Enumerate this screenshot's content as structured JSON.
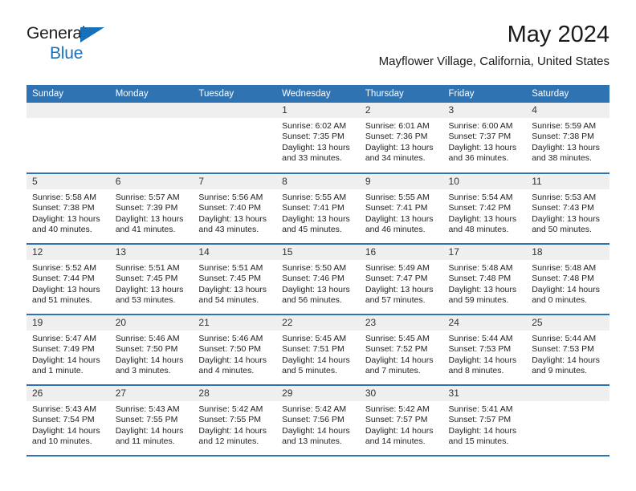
{
  "brand": {
    "name_part1": "General",
    "name_part2": "Blue",
    "triangle_color": "#1a70b8"
  },
  "header": {
    "title": "May 2024",
    "subtitle": "Mayflower Village, California, United States"
  },
  "colors": {
    "header_blue": "#2f73b3",
    "daynum_band": "#efefef",
    "cell_background": "#ffffff"
  },
  "calendar": {
    "weekday_headers": [
      "Sunday",
      "Monday",
      "Tuesday",
      "Wednesday",
      "Thursday",
      "Friday",
      "Saturday"
    ],
    "labels": {
      "sunrise": "Sunrise:",
      "sunset": "Sunset:",
      "daylight": "Daylight:"
    },
    "weeks": [
      [
        {
          "day": "",
          "empty": true,
          "sunrise": "",
          "sunset": "",
          "daylight_line1": "",
          "daylight_line2": ""
        },
        {
          "day": "",
          "empty": true,
          "sunrise": "",
          "sunset": "",
          "daylight_line1": "",
          "daylight_line2": ""
        },
        {
          "day": "",
          "empty": true,
          "sunrise": "",
          "sunset": "",
          "daylight_line1": "",
          "daylight_line2": ""
        },
        {
          "day": "1",
          "empty": false,
          "sunrise": "Sunrise: 6:02 AM",
          "sunset": "Sunset: 7:35 PM",
          "daylight_line1": "Daylight: 13 hours",
          "daylight_line2": "and 33 minutes."
        },
        {
          "day": "2",
          "empty": false,
          "sunrise": "Sunrise: 6:01 AM",
          "sunset": "Sunset: 7:36 PM",
          "daylight_line1": "Daylight: 13 hours",
          "daylight_line2": "and 34 minutes."
        },
        {
          "day": "3",
          "empty": false,
          "sunrise": "Sunrise: 6:00 AM",
          "sunset": "Sunset: 7:37 PM",
          "daylight_line1": "Daylight: 13 hours",
          "daylight_line2": "and 36 minutes."
        },
        {
          "day": "4",
          "empty": false,
          "sunrise": "Sunrise: 5:59 AM",
          "sunset": "Sunset: 7:38 PM",
          "daylight_line1": "Daylight: 13 hours",
          "daylight_line2": "and 38 minutes."
        }
      ],
      [
        {
          "day": "5",
          "empty": false,
          "sunrise": "Sunrise: 5:58 AM",
          "sunset": "Sunset: 7:38 PM",
          "daylight_line1": "Daylight: 13 hours",
          "daylight_line2": "and 40 minutes."
        },
        {
          "day": "6",
          "empty": false,
          "sunrise": "Sunrise: 5:57 AM",
          "sunset": "Sunset: 7:39 PM",
          "daylight_line1": "Daylight: 13 hours",
          "daylight_line2": "and 41 minutes."
        },
        {
          "day": "7",
          "empty": false,
          "sunrise": "Sunrise: 5:56 AM",
          "sunset": "Sunset: 7:40 PM",
          "daylight_line1": "Daylight: 13 hours",
          "daylight_line2": "and 43 minutes."
        },
        {
          "day": "8",
          "empty": false,
          "sunrise": "Sunrise: 5:55 AM",
          "sunset": "Sunset: 7:41 PM",
          "daylight_line1": "Daylight: 13 hours",
          "daylight_line2": "and 45 minutes."
        },
        {
          "day": "9",
          "empty": false,
          "sunrise": "Sunrise: 5:55 AM",
          "sunset": "Sunset: 7:41 PM",
          "daylight_line1": "Daylight: 13 hours",
          "daylight_line2": "and 46 minutes."
        },
        {
          "day": "10",
          "empty": false,
          "sunrise": "Sunrise: 5:54 AM",
          "sunset": "Sunset: 7:42 PM",
          "daylight_line1": "Daylight: 13 hours",
          "daylight_line2": "and 48 minutes."
        },
        {
          "day": "11",
          "empty": false,
          "sunrise": "Sunrise: 5:53 AM",
          "sunset": "Sunset: 7:43 PM",
          "daylight_line1": "Daylight: 13 hours",
          "daylight_line2": "and 50 minutes."
        }
      ],
      [
        {
          "day": "12",
          "empty": false,
          "sunrise": "Sunrise: 5:52 AM",
          "sunset": "Sunset: 7:44 PM",
          "daylight_line1": "Daylight: 13 hours",
          "daylight_line2": "and 51 minutes."
        },
        {
          "day": "13",
          "empty": false,
          "sunrise": "Sunrise: 5:51 AM",
          "sunset": "Sunset: 7:45 PM",
          "daylight_line1": "Daylight: 13 hours",
          "daylight_line2": "and 53 minutes."
        },
        {
          "day": "14",
          "empty": false,
          "sunrise": "Sunrise: 5:51 AM",
          "sunset": "Sunset: 7:45 PM",
          "daylight_line1": "Daylight: 13 hours",
          "daylight_line2": "and 54 minutes."
        },
        {
          "day": "15",
          "empty": false,
          "sunrise": "Sunrise: 5:50 AM",
          "sunset": "Sunset: 7:46 PM",
          "daylight_line1": "Daylight: 13 hours",
          "daylight_line2": "and 56 minutes."
        },
        {
          "day": "16",
          "empty": false,
          "sunrise": "Sunrise: 5:49 AM",
          "sunset": "Sunset: 7:47 PM",
          "daylight_line1": "Daylight: 13 hours",
          "daylight_line2": "and 57 minutes."
        },
        {
          "day": "17",
          "empty": false,
          "sunrise": "Sunrise: 5:48 AM",
          "sunset": "Sunset: 7:48 PM",
          "daylight_line1": "Daylight: 13 hours",
          "daylight_line2": "and 59 minutes."
        },
        {
          "day": "18",
          "empty": false,
          "sunrise": "Sunrise: 5:48 AM",
          "sunset": "Sunset: 7:48 PM",
          "daylight_line1": "Daylight: 14 hours",
          "daylight_line2": "and 0 minutes."
        }
      ],
      [
        {
          "day": "19",
          "empty": false,
          "sunrise": "Sunrise: 5:47 AM",
          "sunset": "Sunset: 7:49 PM",
          "daylight_line1": "Daylight: 14 hours",
          "daylight_line2": "and 1 minute."
        },
        {
          "day": "20",
          "empty": false,
          "sunrise": "Sunrise: 5:46 AM",
          "sunset": "Sunset: 7:50 PM",
          "daylight_line1": "Daylight: 14 hours",
          "daylight_line2": "and 3 minutes."
        },
        {
          "day": "21",
          "empty": false,
          "sunrise": "Sunrise: 5:46 AM",
          "sunset": "Sunset: 7:50 PM",
          "daylight_line1": "Daylight: 14 hours",
          "daylight_line2": "and 4 minutes."
        },
        {
          "day": "22",
          "empty": false,
          "sunrise": "Sunrise: 5:45 AM",
          "sunset": "Sunset: 7:51 PM",
          "daylight_line1": "Daylight: 14 hours",
          "daylight_line2": "and 5 minutes."
        },
        {
          "day": "23",
          "empty": false,
          "sunrise": "Sunrise: 5:45 AM",
          "sunset": "Sunset: 7:52 PM",
          "daylight_line1": "Daylight: 14 hours",
          "daylight_line2": "and 7 minutes."
        },
        {
          "day": "24",
          "empty": false,
          "sunrise": "Sunrise: 5:44 AM",
          "sunset": "Sunset: 7:53 PM",
          "daylight_line1": "Daylight: 14 hours",
          "daylight_line2": "and 8 minutes."
        },
        {
          "day": "25",
          "empty": false,
          "sunrise": "Sunrise: 5:44 AM",
          "sunset": "Sunset: 7:53 PM",
          "daylight_line1": "Daylight: 14 hours",
          "daylight_line2": "and 9 minutes."
        }
      ],
      [
        {
          "day": "26",
          "empty": false,
          "sunrise": "Sunrise: 5:43 AM",
          "sunset": "Sunset: 7:54 PM",
          "daylight_line1": "Daylight: 14 hours",
          "daylight_line2": "and 10 minutes."
        },
        {
          "day": "27",
          "empty": false,
          "sunrise": "Sunrise: 5:43 AM",
          "sunset": "Sunset: 7:55 PM",
          "daylight_line1": "Daylight: 14 hours",
          "daylight_line2": "and 11 minutes."
        },
        {
          "day": "28",
          "empty": false,
          "sunrise": "Sunrise: 5:42 AM",
          "sunset": "Sunset: 7:55 PM",
          "daylight_line1": "Daylight: 14 hours",
          "daylight_line2": "and 12 minutes."
        },
        {
          "day": "29",
          "empty": false,
          "sunrise": "Sunrise: 5:42 AM",
          "sunset": "Sunset: 7:56 PM",
          "daylight_line1": "Daylight: 14 hours",
          "daylight_line2": "and 13 minutes."
        },
        {
          "day": "30",
          "empty": false,
          "sunrise": "Sunrise: 5:42 AM",
          "sunset": "Sunset: 7:57 PM",
          "daylight_line1": "Daylight: 14 hours",
          "daylight_line2": "and 14 minutes."
        },
        {
          "day": "31",
          "empty": false,
          "sunrise": "Sunrise: 5:41 AM",
          "sunset": "Sunset: 7:57 PM",
          "daylight_line1": "Daylight: 14 hours",
          "daylight_line2": "and 15 minutes."
        },
        {
          "day": "",
          "empty": true,
          "sunrise": "",
          "sunset": "",
          "daylight_line1": "",
          "daylight_line2": ""
        }
      ]
    ]
  }
}
